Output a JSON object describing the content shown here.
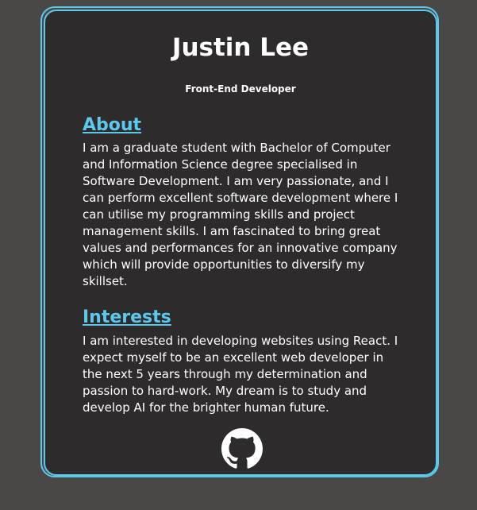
{
  "profile": {
    "name": "Justin Lee",
    "role": "Front-End Developer"
  },
  "about": {
    "heading": "About",
    "text": "I am a graduate student with Bachelor of Computer and Information Science degree specialised in Software Development. I am very passionate, and I can perform excellent software development where I can utilise my programming skills and project management skills. I am fascinated to bring great values and performances for an innovative company which will provide opportunities to diversify my skillset."
  },
  "interests": {
    "heading": "Interests",
    "text": "I am interested in developing websites using React. I expect myself to be an excellent web developer in the next 5 years through my determination and passion to hard-work. My dream is to study and develop AI for the brighter human future."
  },
  "footer": {
    "icon": "github-icon"
  },
  "colors": {
    "page_background": "#4a4846",
    "card_background": "#2d2b2b",
    "accent": "#5cc9ec",
    "text": "#ffffff"
  }
}
